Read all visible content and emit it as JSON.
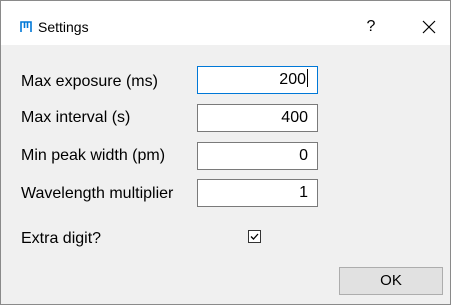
{
  "window": {
    "title": "Settings",
    "help_label": "?",
    "close_icon": "close-icon",
    "app_icon": "app-icon",
    "accent_color": "#0078d7"
  },
  "fields": [
    {
      "label": "Max exposure (ms)",
      "value": "200"
    },
    {
      "label": "Max interval (s)",
      "value": "400"
    },
    {
      "label": "Min peak width (pm)",
      "value": "0"
    },
    {
      "label": "Wavelength multiplier",
      "value": "1"
    }
  ],
  "checkbox": {
    "label": "Extra digit?",
    "checked": true
  },
  "buttons": {
    "ok_label": "OK"
  }
}
